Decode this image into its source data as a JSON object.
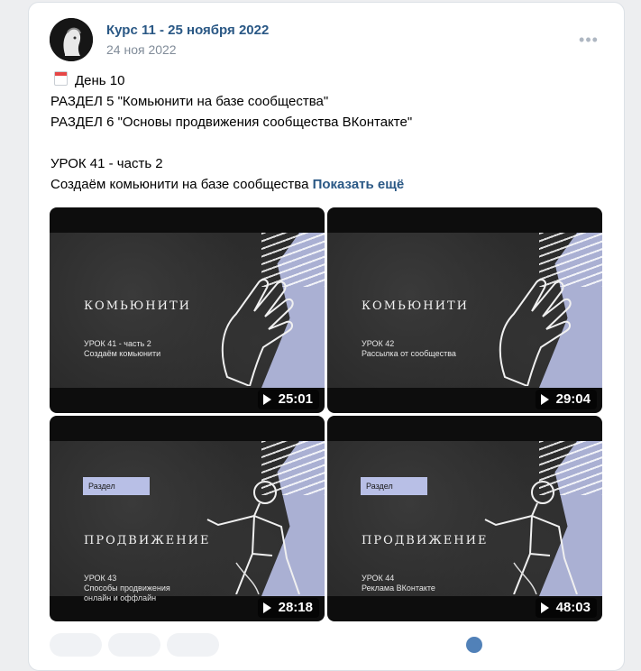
{
  "post": {
    "author": "Курс 11 - 25 ноября 2022",
    "date": "24 ноя 2022",
    "more_icon": "•••",
    "lines": [
      "День 10",
      "РАЗДЕЛ 5 \"Комьюнити на базе сообщества\"",
      "РАЗДЕЛ 6 \"Основы продвижения сообщества ВКонтакте\"",
      "",
      "УРОК 41 - часть 2",
      "Создаём комьюнити на базе сообщества"
    ],
    "show_more": "Показать ещё"
  },
  "videos": [
    {
      "tag": "",
      "title": "КОМЬЮНИТИ",
      "subtitle": "УРОК 41 - часть 2\nСоздаём комьюнити",
      "duration": "25:01",
      "art_icon": "hand-icon"
    },
    {
      "tag": "",
      "title": "КОМЬЮНИТИ",
      "subtitle": "УРОК 42\nРассылка от сообщества",
      "duration": "29:04",
      "art_icon": "hand-icon"
    },
    {
      "tag": "Раздел",
      "title": "ПРОДВИЖЕНИЕ",
      "subtitle": "УРОК 43\nСпособы продвижения\nонлайн и оффлайн",
      "duration": "28:18",
      "art_icon": "statue-icon"
    },
    {
      "tag": "Раздел",
      "title": "ПРОДВИЖЕНИЕ",
      "subtitle": "УРОК 44\nРеклама ВКонтакте",
      "duration": "48:03",
      "art_icon": "statue-icon"
    }
  ],
  "colors": {
    "link": "#2a5885",
    "accent": "#b8bfe6",
    "muted": "#818c99"
  }
}
